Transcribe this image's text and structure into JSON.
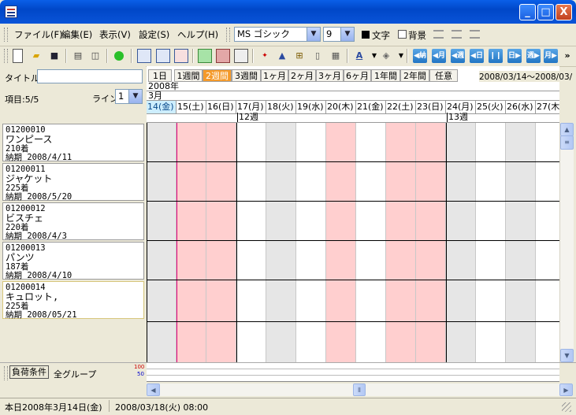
{
  "window": {
    "title": "",
    "buttons": {
      "minimize": "_",
      "maximize": "□",
      "close": "X"
    }
  },
  "menu": {
    "file": "ファイル(F)",
    "edit": "編集(E)",
    "view": "表示(V)",
    "settings": "設定(S)",
    "help": "ヘルプ(H)"
  },
  "format": {
    "font": "MS ゴシック",
    "size": "9",
    "text_label": "文字",
    "bg_label": "背景"
  },
  "left": {
    "title_label": "タイトル",
    "title_value": "",
    "item_count": "項目:5/5",
    "line_label": "ライン",
    "line_value": "1",
    "items": [
      {
        "code": "01200010",
        "name": "ワンピース",
        "qty": "210着",
        "due": "納期 2008/4/11"
      },
      {
        "code": "01200011",
        "name": "ジャケット",
        "qty": "225着",
        "due": "納期 2008/5/20"
      },
      {
        "code": "01200012",
        "name": "ビスチェ",
        "qty": "220着",
        "due": "納期 2008/4/3"
      },
      {
        "code": "01200013",
        "name": "パンツ",
        "qty": "187着",
        "due": "納期 2008/4/10"
      },
      {
        "code": "01200014",
        "name": "キュロット,",
        "qty": "225着",
        "due": "納期 2008/05/21"
      }
    ]
  },
  "tabs": [
    "1日",
    "1週間",
    "2週間",
    "3週間",
    "1ヶ月",
    "2ヶ月",
    "3ヶ月",
    "6ヶ月",
    "1年間",
    "2年間",
    "任意"
  ],
  "active_tab": "2週間",
  "date_range": "2008/03/14～2008/03/",
  "calendar": {
    "year": "2008年",
    "month": "3月",
    "days": [
      "14(金)",
      "15(土)",
      "16(日)",
      "17(月)",
      "18(火)",
      "19(水)",
      "20(木)",
      "21(金)",
      "22(土)",
      "23(日)",
      "24(月)",
      "25(火)",
      "26(水)",
      "27(木"
    ],
    "weeks": [
      "12週",
      "13週"
    ]
  },
  "load": {
    "button": "負荷条件",
    "group": "全グループ",
    "scale_top": "100",
    "scale_bottom": "50"
  },
  "status": {
    "today": "本日2008年3月14日(金)",
    "datetime": "2008/03/18(火) 08:00"
  },
  "colors": {
    "weekend": "#ffcfcf",
    "grey_col": "#e6e6e6",
    "active_tab": "#f59a2a",
    "title_blue": "#0a54d8"
  }
}
